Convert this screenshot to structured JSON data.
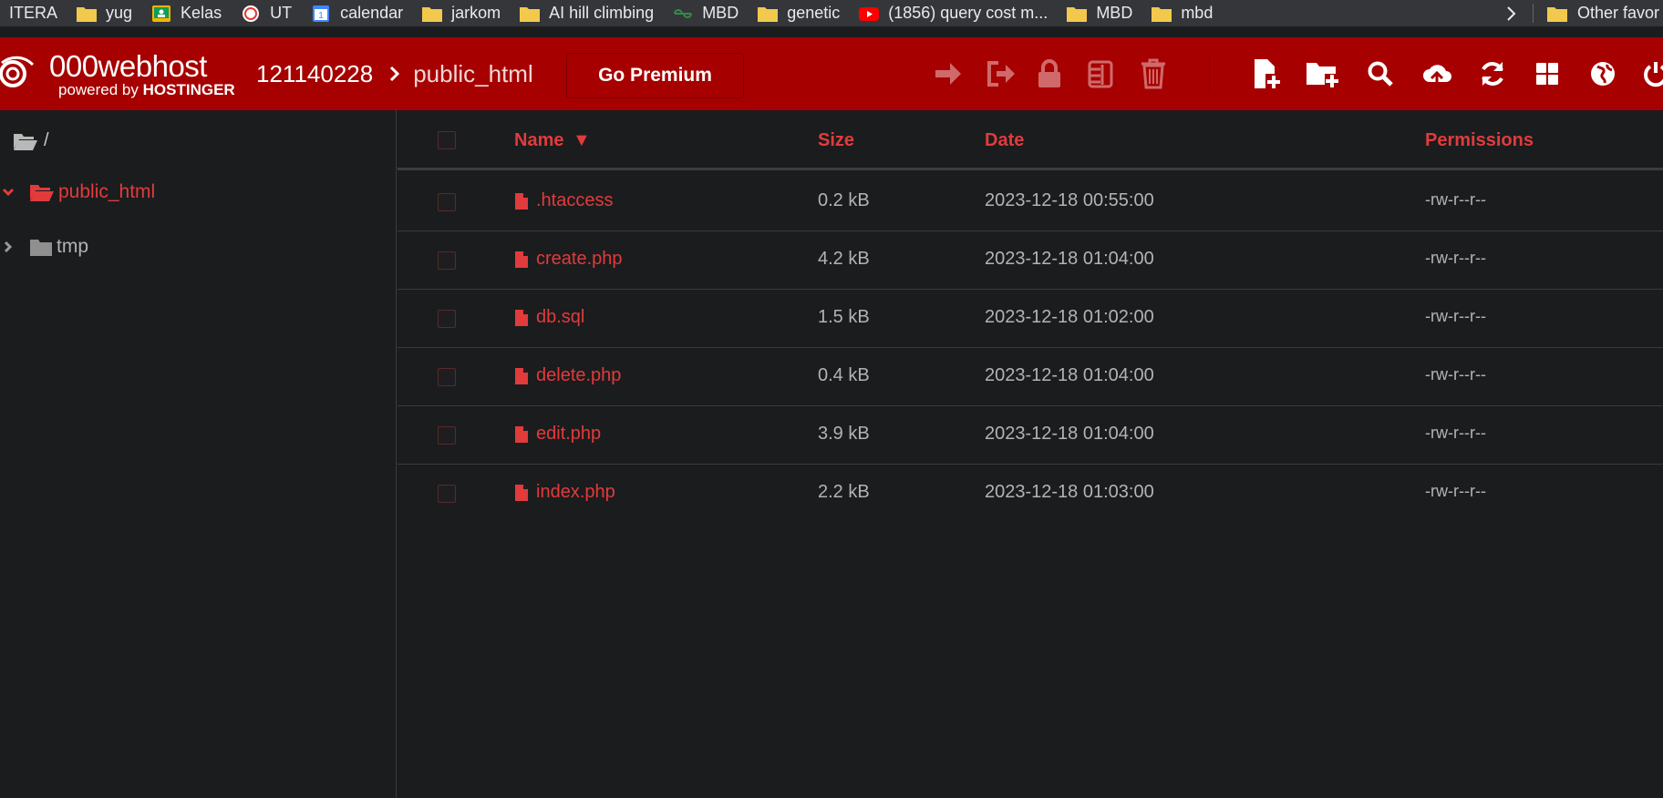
{
  "bookmarks": {
    "items": [
      {
        "label": "ITERA",
        "icon": "none"
      },
      {
        "label": "yug",
        "icon": "folder-icon"
      },
      {
        "label": "Kelas",
        "icon": "classroom-icon"
      },
      {
        "label": "UT",
        "icon": "ut-logo-icon"
      },
      {
        "label": "calendar",
        "icon": "calendar-icon"
      },
      {
        "label": "jarkom",
        "icon": "folder-icon"
      },
      {
        "label": "AI hill climbing",
        "icon": "folder-icon"
      },
      {
        "label": "MBD",
        "icon": "gfg-icon"
      },
      {
        "label": "genetic",
        "icon": "folder-icon"
      },
      {
        "label": "(1856) query cost m...",
        "icon": "youtube-icon"
      },
      {
        "label": "MBD",
        "icon": "folder-icon"
      },
      {
        "label": "mbd",
        "icon": "folder-icon"
      }
    ],
    "other_label": "Other favor"
  },
  "header": {
    "logo_main": "000webhost",
    "logo_sub_prefix": "powered by ",
    "logo_sub_brand": "HOSTINGER",
    "breadcrumb_root": "121140228",
    "breadcrumb_current": "public_html",
    "premium_label": "Go Premium"
  },
  "sidebar": {
    "root_label": "/",
    "items": [
      {
        "label": "public_html",
        "expanded": true,
        "active": true
      },
      {
        "label": "tmp",
        "expanded": false,
        "active": false
      }
    ]
  },
  "table": {
    "headers": {
      "name": "Name",
      "sort_indicator": "▼",
      "size": "Size",
      "date": "Date",
      "permissions": "Permissions"
    },
    "rows": [
      {
        "name": ".htaccess",
        "size": "0.2 kB",
        "date": "2023-12-18 00:55:00",
        "permissions": "-rw-r--r--"
      },
      {
        "name": "create.php",
        "size": "4.2 kB",
        "date": "2023-12-18 01:04:00",
        "permissions": "-rw-r--r--"
      },
      {
        "name": "db.sql",
        "size": "1.5 kB",
        "date": "2023-12-18 01:02:00",
        "permissions": "-rw-r--r--"
      },
      {
        "name": "delete.php",
        "size": "0.4 kB",
        "date": "2023-12-18 01:04:00",
        "permissions": "-rw-r--r--"
      },
      {
        "name": "edit.php",
        "size": "3.9 kB",
        "date": "2023-12-18 01:04:00",
        "permissions": "-rw-r--r--"
      },
      {
        "name": "index.php",
        "size": "2.2 kB",
        "date": "2023-12-18 01:03:00",
        "permissions": "-rw-r--r--"
      }
    ]
  },
  "colors": {
    "header_bg": "#a60000",
    "accent": "#e23b3b",
    "page_bg": "#1b1c1e",
    "bookmarks_bg": "#35363a"
  }
}
